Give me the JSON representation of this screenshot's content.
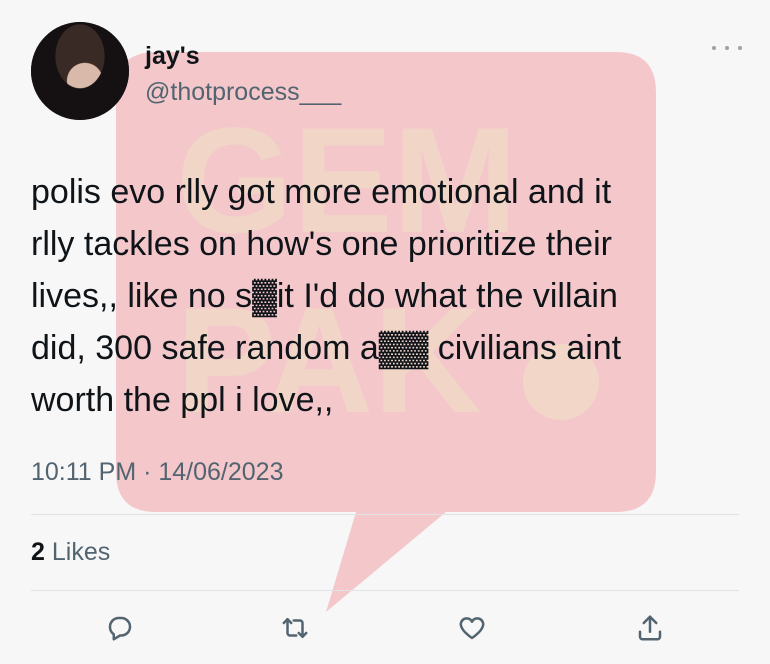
{
  "user": {
    "display_name": "jay's",
    "handle": "@thotprocess___"
  },
  "tweet": {
    "text": "polis evo rlly got more emotional and it\nrlly tackles on how's one prioritize their\nlives,, like no s▓it I'd do what the villain\ndid, 300 safe random a▓▓ civilians aint\nworth the ppl i love,,",
    "timestamp": "10:11 PM · 14/06/2023"
  },
  "engagement": {
    "likes_count": "2",
    "likes_label": "Likes"
  },
  "watermark": {
    "line1": "GEM",
    "line2": "PAK"
  },
  "icons": {
    "reply": "reply-icon",
    "retweet": "retweet-icon",
    "like": "heart-icon",
    "share": "share-icon",
    "more": "more-icon"
  },
  "colors": {
    "watermark_red": "#f2a3a8",
    "watermark_text": "#efe3c4",
    "secondary_text": "#536471"
  }
}
